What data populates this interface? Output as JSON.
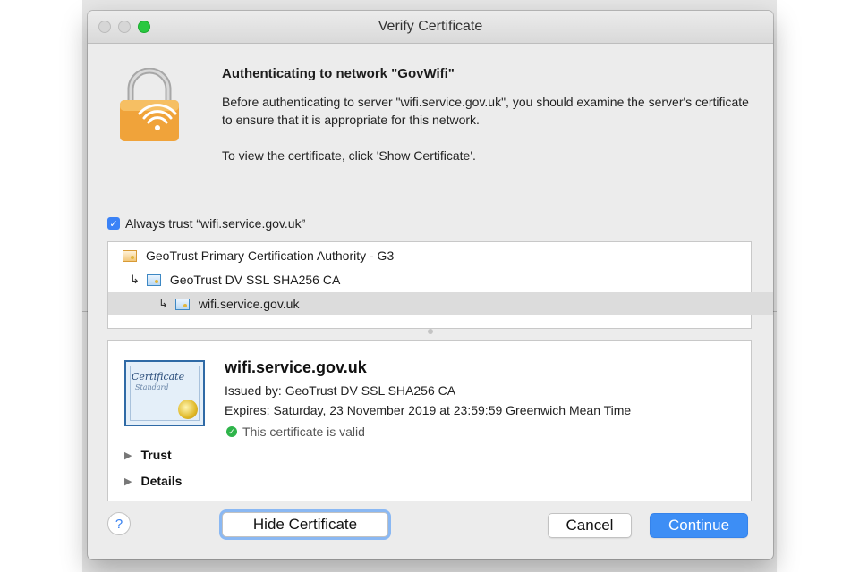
{
  "window": {
    "title": "Verify Certificate"
  },
  "header": {
    "heading": "Authenticating to network \"GovWifi\"",
    "paragraph1": "Before authenticating to server \"wifi.service.gov.uk\", you should examine the server's certificate to ensure that it is appropriate for this network.",
    "paragraph2": "To view the certificate, click 'Show Certificate'."
  },
  "always_trust": {
    "label": "Always trust “wifi.service.gov.uk”",
    "checked": true
  },
  "cert_chain": [
    {
      "label": "GeoTrust Primary Certification Authority - G3",
      "level": 0,
      "selected": false
    },
    {
      "label": "GeoTrust DV SSL SHA256 CA",
      "level": 1,
      "selected": false
    },
    {
      "label": "wifi.service.gov.uk",
      "level": 2,
      "selected": true
    }
  ],
  "detail": {
    "name": "wifi.service.gov.uk",
    "issued_by": "Issued by: GeoTrust DV SSL SHA256 CA",
    "expires": "Expires: Saturday, 23 November 2019 at 23:59:59 Greenwich Mean Time",
    "status": "This certificate is valid",
    "cert_icon_text": "Certificate",
    "cert_icon_subtext": "Standard",
    "sections": [
      "Trust",
      "Details"
    ]
  },
  "buttons": {
    "help": "?",
    "hide_certificate": "Hide Certificate",
    "cancel": "Cancel",
    "continue": "Continue"
  },
  "colors": {
    "accent": "#3d8ef5",
    "valid": "#2eb44a",
    "lock_body": "#f0a33a"
  }
}
